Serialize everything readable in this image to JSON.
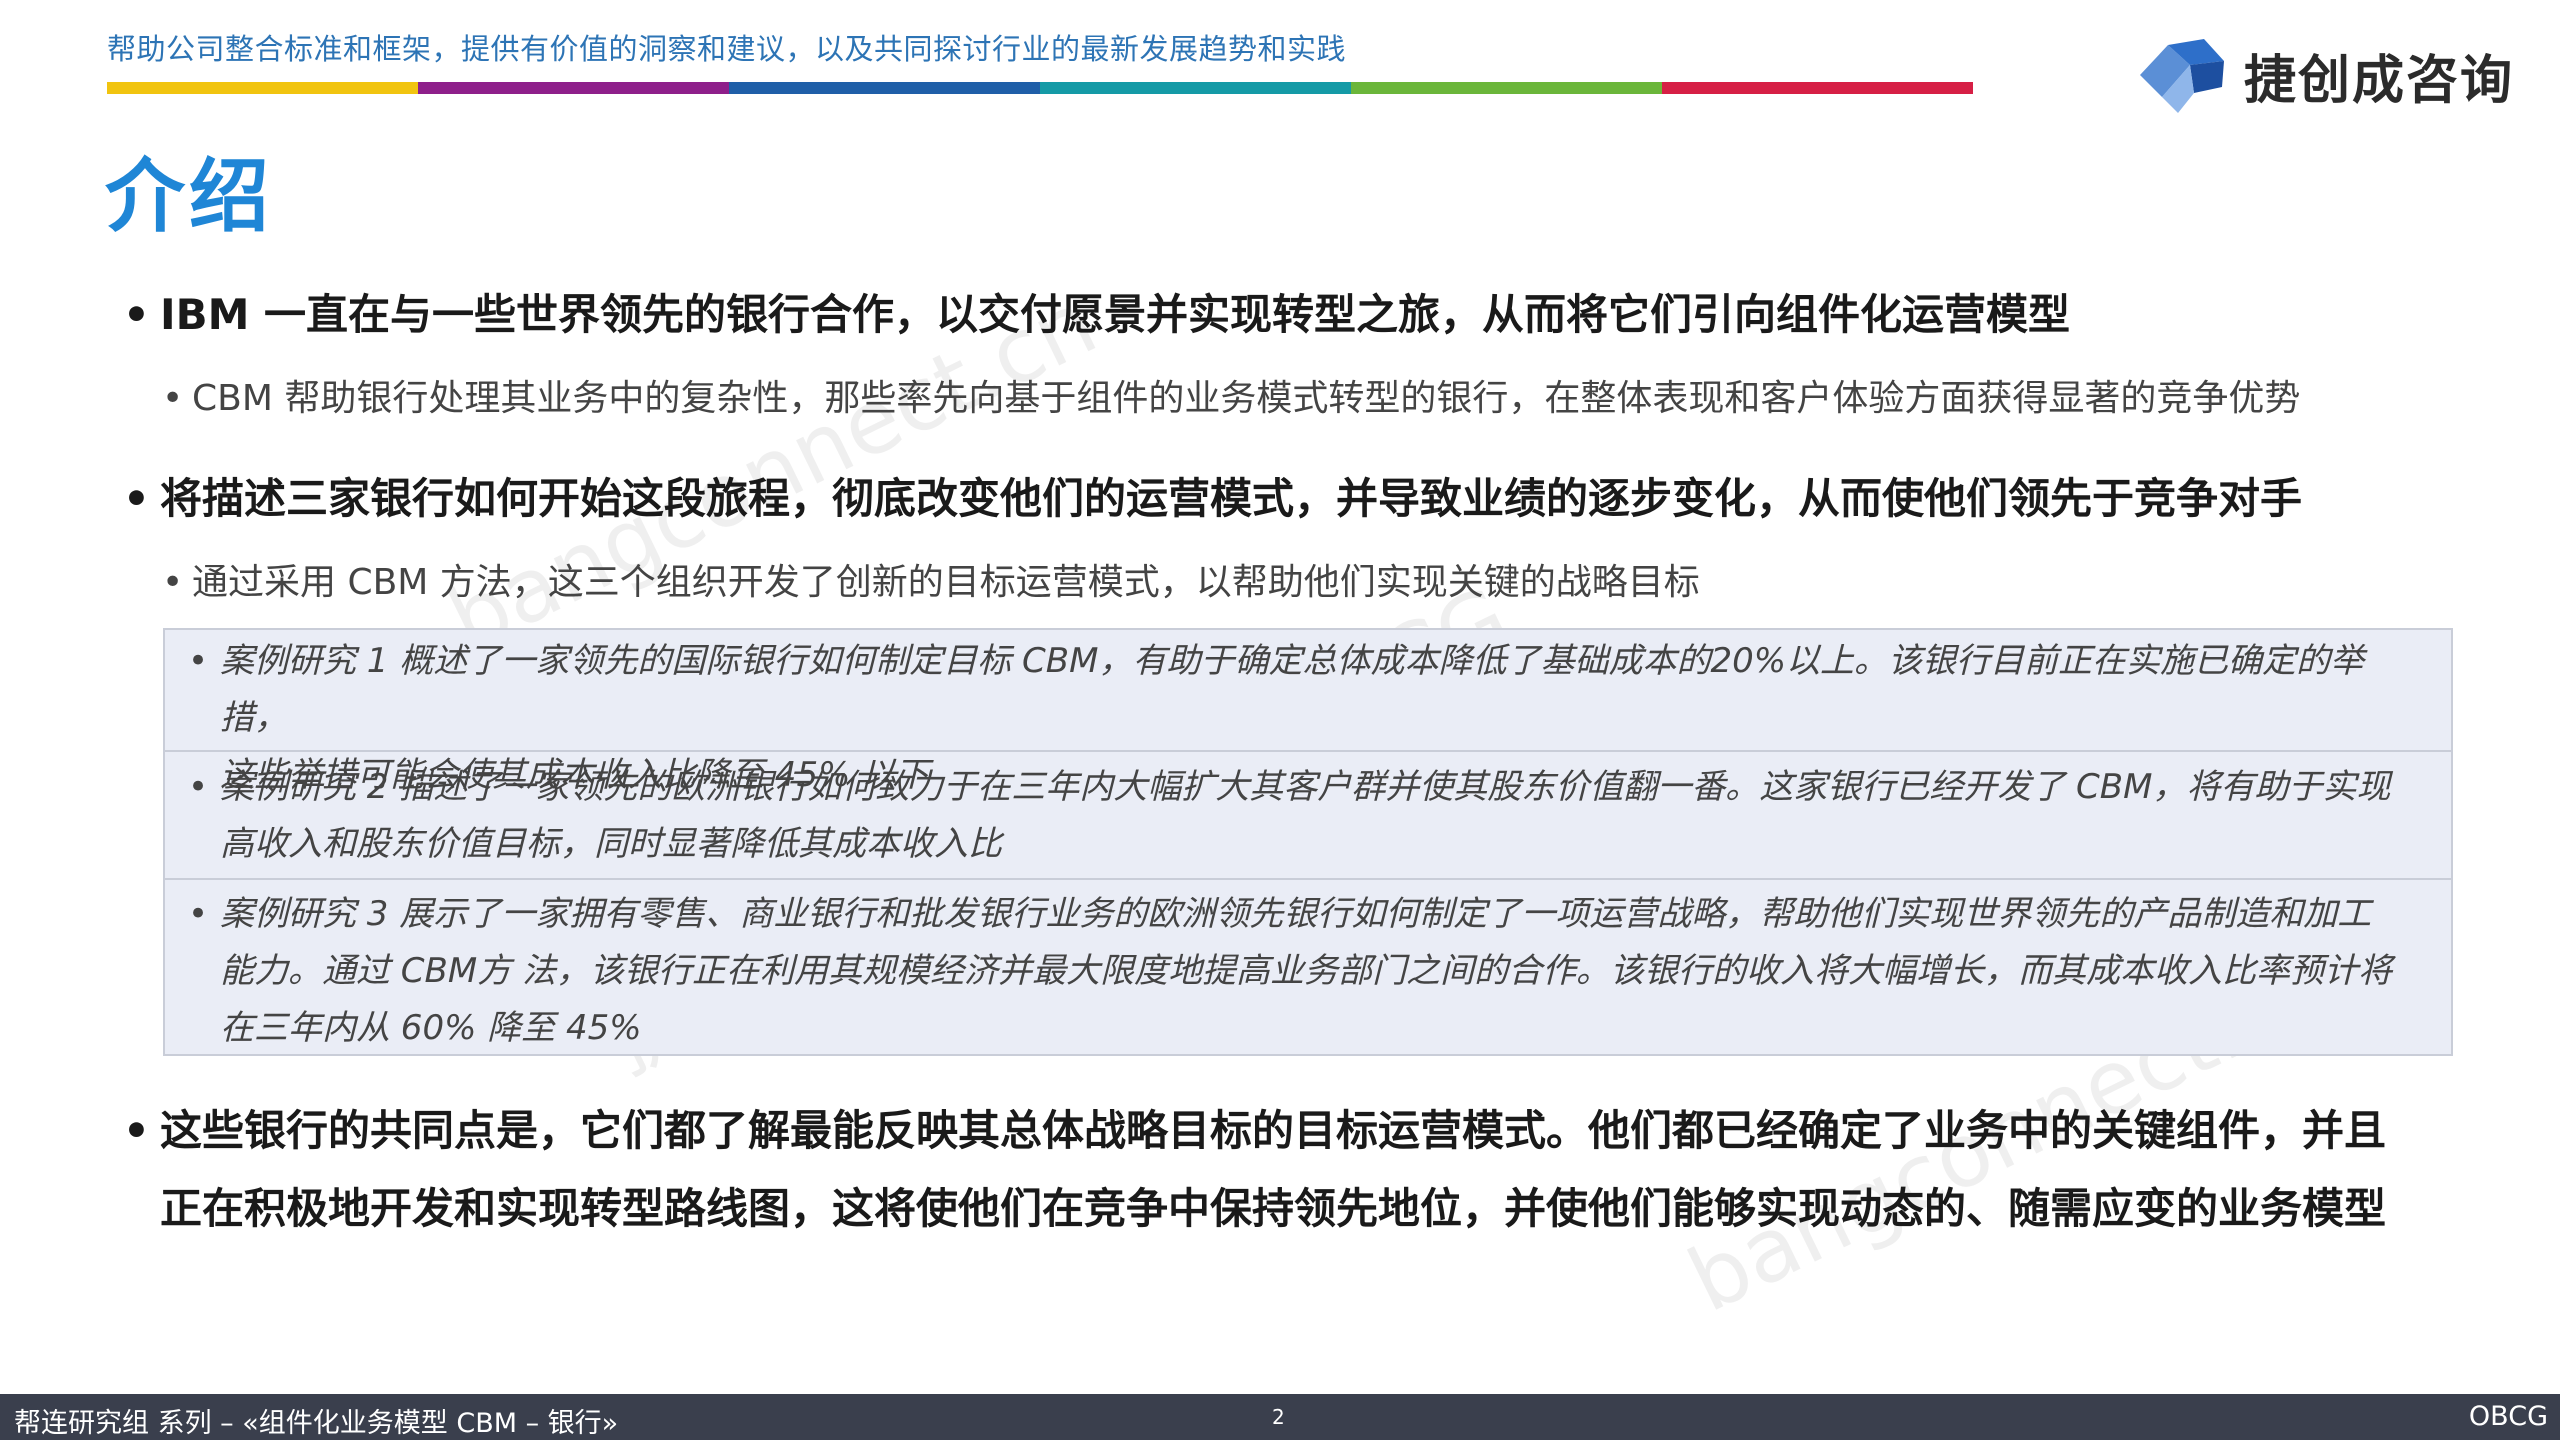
{
  "header": {
    "tagline": "帮助公司整合标准和框架，提供有价值的洞察和建议，以及共同探讨行业的最新发展趋势和实践",
    "logo_text": "捷创成咨询",
    "bar_colors": [
      "#f1c40f",
      "#8e1f8a",
      "#1f5fa8",
      "#159aa6",
      "#6bb63a",
      "#d61f45"
    ]
  },
  "title": "介绍",
  "watermarks": [
    "bangconnect.cn",
    "捷创成帮连研究组 OBCG",
    "bangconnect.cn"
  ],
  "bullets": {
    "b1": "IBM 一直在与一些世界领先的银行合作，以交付愿景并实现转型之旅，从而将它们引向组件化运营模型",
    "b1_sub": "CBM 帮助银行处理其业务中的复杂性，那些率先向基于组件的业务模式转型的银行，在整体表现和客户体验方面获得显著的竞争优势",
    "b2": "将描述三家银行如何开始这段旅程，彻底改变他们的运营模式，并导致业绩的逐步变化，从而使他们领先于竞争对手",
    "b2_sub": "通过采用 CBM 方法，这三个组织开发了创新的目标运营模式，以帮助他们实现关键的战略目标",
    "b3_line1": "这些银行的共同点是，它们都了解最能反映其总体战略目标的目标运营模式。他们都已经确定了业务中的关键组件，并且",
    "b3_line2": "正在积极地开发和实现转型路线图，这将使他们在竞争中保持领先地位，并使他们能够实现动态的、随需应变的业务模型"
  },
  "cases": [
    {
      "line1": "案例研究 1 概述了一家领先的国际银行如何制定目标 CBM，有助于确定总体成本降低了基础成本的20%以上。该银行目前正在实施已确定的举措，",
      "line2": "这些举措可能会使其成本收入比降至 45% 以下"
    },
    {
      "line1": "案例研究 2 描述了一家领先的欧洲银行如何致力于在三年内大幅扩大其客户群并使其股东价值翻一番。这家银行已经开发了 CBM，将有助于实现",
      "line2": "高收入和股东价值目标，同时显著降低其成本收入比"
    },
    {
      "line1": "案例研究 3 展示了一家拥有零售、商业银行和批发银行业务的欧洲领先银行如何制定了一项运营战略，帮助他们实现世界领先的产品制造和加工",
      "line2": "能力。通过 CBM方 法，该银行正在利用其规模经济并最大限度地提高业务部门之间的合作。该银行的收入将大幅增长，而其成本收入比率预计将",
      "line3": "在三年内从 60% 降至 45%"
    }
  ],
  "footer": {
    "left": "帮连研究组 系列 – «组件化业务模型 CBM – 银行»",
    "page": "2",
    "right": "OBCG"
  }
}
